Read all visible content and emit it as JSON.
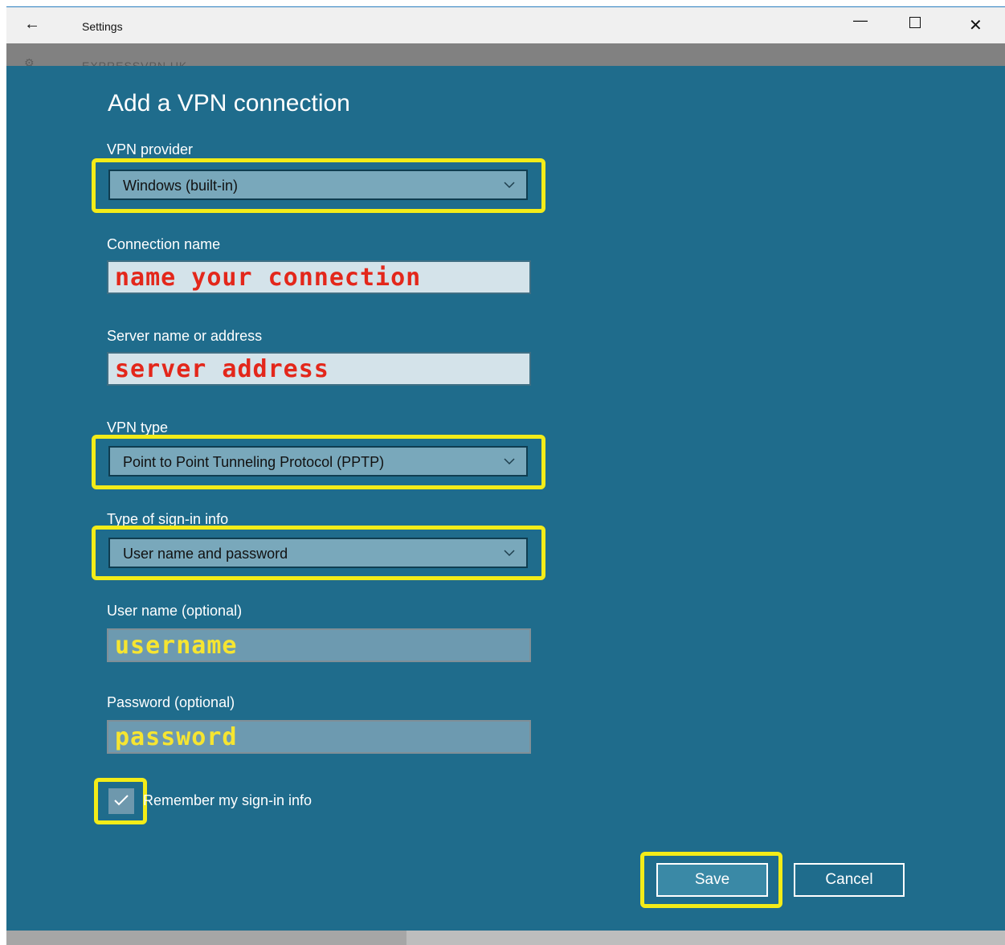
{
  "window": {
    "back_icon": "back-arrow-icon",
    "title": "Settings",
    "controls": [
      "minimize-icon",
      "maximize-icon",
      "close-icon"
    ]
  },
  "background": {
    "partial_icon": "gear-icon",
    "partial_text": "EXPRESSVPN UK"
  },
  "dialog": {
    "title": "Add a VPN connection",
    "vpn_provider": {
      "label": "VPN provider",
      "value": "Windows (built-in)"
    },
    "connection_name": {
      "label": "Connection name",
      "value": "name your connection"
    },
    "server": {
      "label": "Server name or address",
      "value": "server address"
    },
    "vpn_type": {
      "label": "VPN type",
      "value": "Point to Point Tunneling Protocol (PPTP)"
    },
    "signin_type": {
      "label": "Type of sign-in info",
      "value": "User name and password"
    },
    "username": {
      "label": "User name (optional)",
      "value": "username"
    },
    "password": {
      "label": "Password (optional)",
      "value": "password"
    },
    "remember": {
      "label": "Remember my sign-in info",
      "checked": true
    },
    "save_label": "Save",
    "cancel_label": "Cancel"
  },
  "colors": {
    "dialog_bg": "#1f6c8c",
    "highlight": "#f3ec18",
    "annotation_red": "#e3271b",
    "annotation_yellow": "#f6e531"
  }
}
